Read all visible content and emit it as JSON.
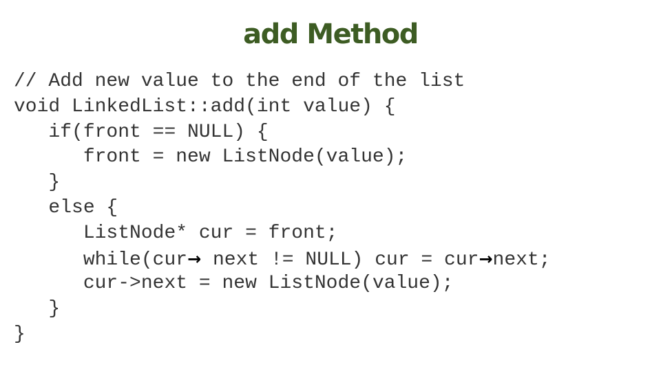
{
  "slide": {
    "title": "add Method",
    "title_color": "#3d5c23",
    "code_lines": [
      {
        "indent": "",
        "text": "// Add new value to the end of the list"
      },
      {
        "indent": "",
        "text": "void LinkedList::add(int value) {"
      },
      {
        "indent": "   ",
        "text": "if(front == NULL) {"
      },
      {
        "indent": "      ",
        "text": "front = new ListNode(value);"
      },
      {
        "indent": "   ",
        "text": "}"
      },
      {
        "indent": "   ",
        "text": "else {"
      },
      {
        "indent": "      ",
        "text": "ListNode* cur = front;"
      },
      {
        "indent": "      ",
        "parts": [
          "while(cur",
          "→",
          " next != NULL) cur = cur",
          "→",
          "next;"
        ]
      },
      {
        "indent": "      ",
        "text": "cur->next = new ListNode(value);"
      },
      {
        "indent": "   ",
        "text": "}"
      },
      {
        "indent": "",
        "text": "}"
      }
    ]
  }
}
